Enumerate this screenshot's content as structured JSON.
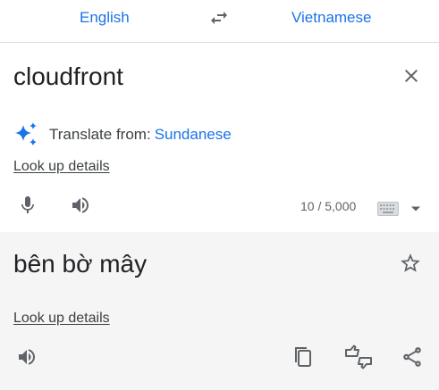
{
  "header": {
    "source_language": "English",
    "target_language": "Vietnamese",
    "swap_icon": "swap-horiz-icon"
  },
  "source": {
    "text": "cloudfront",
    "clear_icon": "close-icon",
    "detect_label": "Translate from:",
    "detect_language": "Sundanese",
    "lookup_label": "Look up details",
    "char_count": "10 / 5,000",
    "icons": [
      "sparkle-icon",
      "mic-icon",
      "speaker-icon",
      "keyboard-icon",
      "chevron-down-icon"
    ]
  },
  "target": {
    "text": "bên bờ mây",
    "lookup_label": "Look up details",
    "icons": [
      "star-icon",
      "speaker-icon",
      "copy-icon",
      "feedback-icon",
      "share-icon"
    ]
  },
  "colors": {
    "accent": "#1a73e8",
    "sparkle": "#1a73e8",
    "icon": "#5f6368",
    "target_bg": "#f5f5f5",
    "divider": "#dadce0"
  }
}
